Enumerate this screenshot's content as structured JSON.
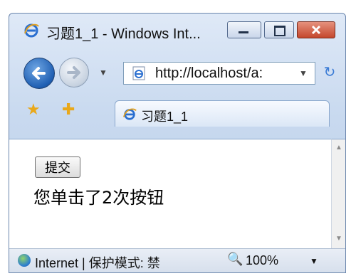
{
  "window": {
    "title": "习题1_1 - Windows Int...",
    "buttons": [
      "minimize",
      "maximize",
      "close"
    ]
  },
  "navigation": {
    "address": "http://localhost/a:",
    "icons": [
      "back-icon",
      "forward-icon",
      "history-dropdown-icon",
      "page-icon",
      "refresh-icon"
    ]
  },
  "tabs": {
    "active_title": "习题1_1"
  },
  "content": {
    "submit_label": "提交",
    "message": "您单击了2次按钮"
  },
  "status": {
    "zone": "Internet | 保护模式: 禁",
    "zoom": "100%"
  },
  "colors": {
    "window_frame": "#c8d9ef",
    "close_button": "#c4472d",
    "back_button": "#1f5fb3"
  }
}
